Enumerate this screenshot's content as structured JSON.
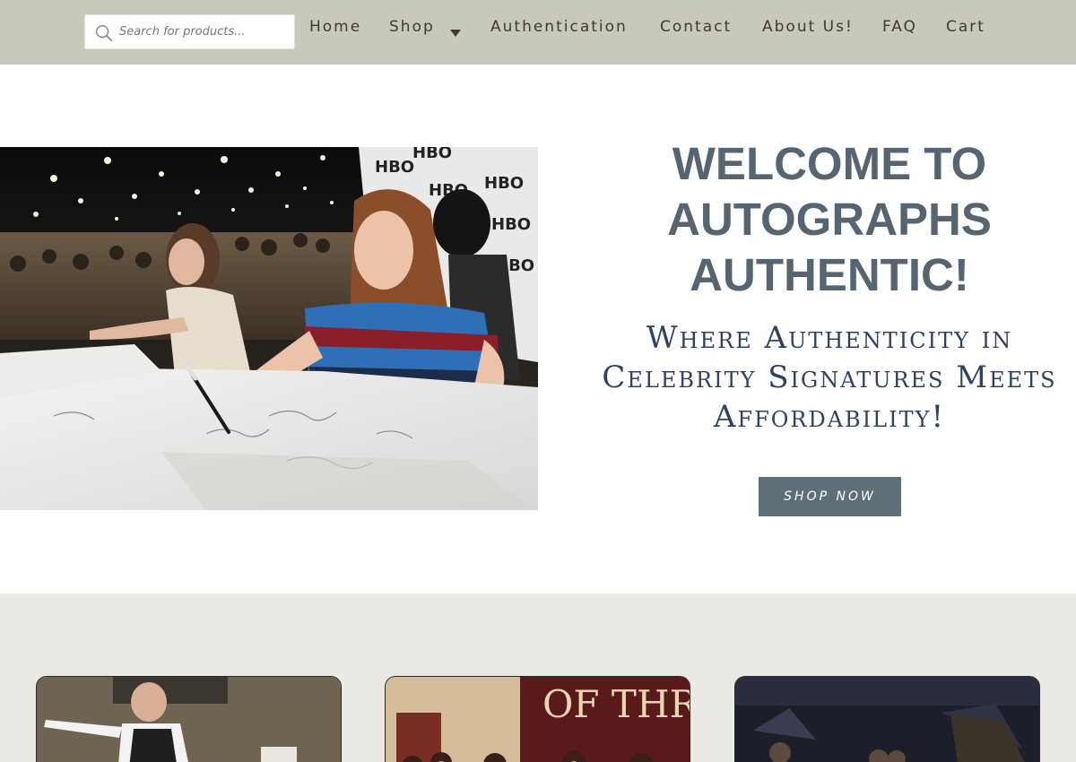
{
  "header": {
    "search": {
      "placeholder": "Search for products..."
    },
    "nav": [
      {
        "label": "Home"
      },
      {
        "label": "Shop"
      },
      {
        "label": "Authentication"
      },
      {
        "label": "Contact"
      },
      {
        "label": "About Us!"
      },
      {
        "label": "FAQ"
      },
      {
        "label": "Cart"
      }
    ]
  },
  "hero": {
    "title": "WELCOME TO AUTOGRAPHS AUTHENTIC!",
    "subtitle": "Where Authenticity in Celebrity Signatures Meets Affordability!",
    "cta_label": "SHOP NOW"
  },
  "colors": {
    "header_bg": "#c9c8bc",
    "title": "#566571",
    "subtitle": "#2f4260",
    "button": "#5f6f77",
    "lower_bg": "#eae9e4"
  },
  "icons": {
    "search": "search-icon",
    "dropdown": "caret-down-icon"
  }
}
